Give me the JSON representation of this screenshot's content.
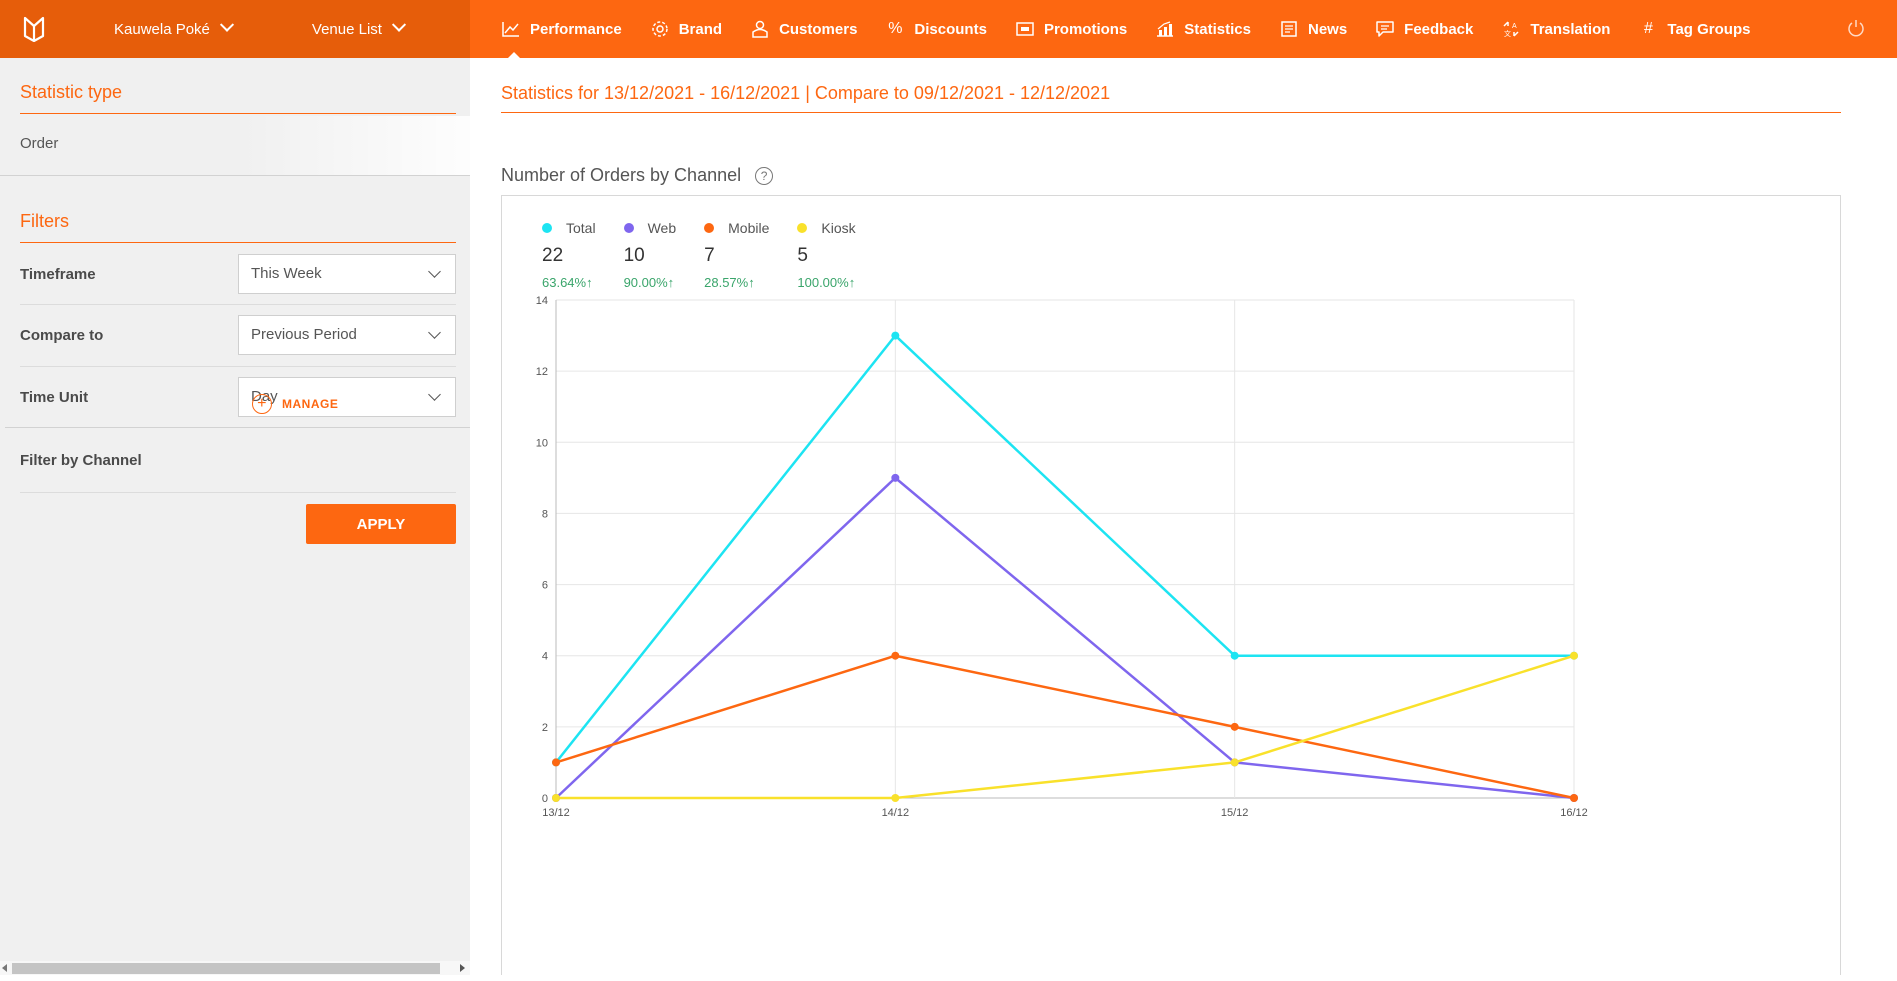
{
  "header": {
    "venue": "Kauwela Poké",
    "venue_list": "Venue List",
    "nav": [
      {
        "label": "Performance",
        "icon": "performance-icon"
      },
      {
        "label": "Brand",
        "icon": "gear-icon"
      },
      {
        "label": "Customers",
        "icon": "customers-icon"
      },
      {
        "label": "Discounts",
        "icon": "percent-icon"
      },
      {
        "label": "Promotions",
        "icon": "promotions-icon"
      },
      {
        "label": "Statistics",
        "icon": "statistics-icon"
      },
      {
        "label": "News",
        "icon": "news-icon"
      },
      {
        "label": "Feedback",
        "icon": "feedback-icon"
      },
      {
        "label": "Translation",
        "icon": "translation-icon"
      },
      {
        "label": "Tag Groups",
        "icon": "hash-icon"
      }
    ]
  },
  "sidebar": {
    "statistic_type_heading": "Statistic type",
    "statistic_type_value": "Order",
    "filters_heading": "Filters",
    "timeframe_label": "Timeframe",
    "timeframe_value": "This Week",
    "compare_label": "Compare to",
    "compare_value": "Previous Period",
    "time_unit_label": "Time Unit",
    "time_unit_value": "Day",
    "channel_label": "Filter by Channel",
    "manage_label": "MANAGE",
    "apply_label": "APPLY"
  },
  "main": {
    "stats_title": "Statistics for 13/12/2021 - 16/12/2021 | Compare to 09/12/2021 - 12/12/2021",
    "chart_title": "Number of Orders by Channel",
    "help_glyph": "?"
  },
  "legend": [
    {
      "name": "Total",
      "value": "22",
      "change": "63.64%↑",
      "color": "#1de4f2"
    },
    {
      "name": "Web",
      "value": "10",
      "change": "90.00%↑",
      "color": "#7f66ee"
    },
    {
      "name": "Mobile",
      "value": "7",
      "change": "28.57%↑",
      "color": "#fd6711"
    },
    {
      "name": "Kiosk",
      "value": "5",
      "change": "100.00%↑",
      "color": "#f9e12b"
    }
  ],
  "chart_data": {
    "type": "line",
    "x": [
      "13/12",
      "14/12",
      "15/12",
      "16/12"
    ],
    "ylim": [
      0,
      14
    ],
    "yticks": [
      0,
      2,
      4,
      6,
      8,
      10,
      12,
      14
    ],
    "grid": true,
    "series": [
      {
        "name": "Total",
        "color": "#1de4f2",
        "values": [
          1,
          13,
          4,
          4
        ]
      },
      {
        "name": "Web",
        "color": "#7f66ee",
        "values": [
          0,
          9,
          1,
          0
        ]
      },
      {
        "name": "Mobile",
        "color": "#fd6711",
        "values": [
          1,
          4,
          2,
          0
        ]
      },
      {
        "name": "Kiosk",
        "color": "#f9e12b",
        "values": [
          0,
          0,
          1,
          4
        ]
      }
    ]
  }
}
